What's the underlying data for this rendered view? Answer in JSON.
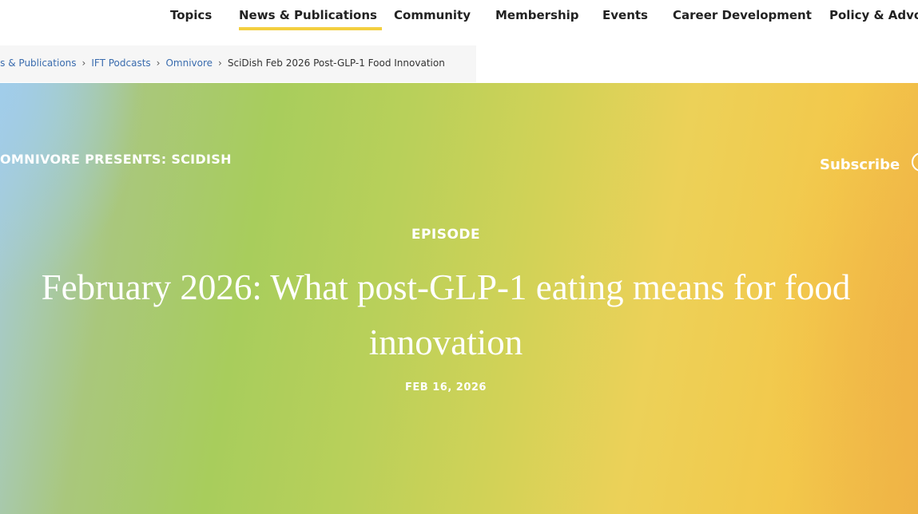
{
  "nav": {
    "items": [
      {
        "label": "Topics"
      },
      {
        "label": "News & Publications",
        "active": true
      },
      {
        "label": "Community"
      },
      {
        "label": "Membership"
      },
      {
        "label": "Events"
      },
      {
        "label": "Career Development"
      },
      {
        "label": "Policy & Advoc"
      }
    ],
    "active_underline_color": "#f3cf3f"
  },
  "breadcrumb": {
    "items": [
      {
        "label": "News & Publications"
      },
      {
        "label": "IFT Podcasts"
      },
      {
        "label": "Omnivore"
      },
      {
        "label": "SciDish Feb 2026 Post-GLP-1 Food Innovation",
        "current": true
      }
    ],
    "separator": "›",
    "link_color": "#3a6cae"
  },
  "hero": {
    "kicker": "OMNIVORE PRESENTS: SCIDISH",
    "subscribe_label": "Subscribe",
    "subscribe_icon": "circle-icon",
    "episode_label": "EPISODE",
    "title": "February 2026: What post-GLP-1 eating means for food innovation",
    "date": "FEB 16, 2026",
    "gradient_colors": [
      "#a6cce4",
      "#a8cd5c",
      "#ecd158",
      "#efb545"
    ]
  }
}
